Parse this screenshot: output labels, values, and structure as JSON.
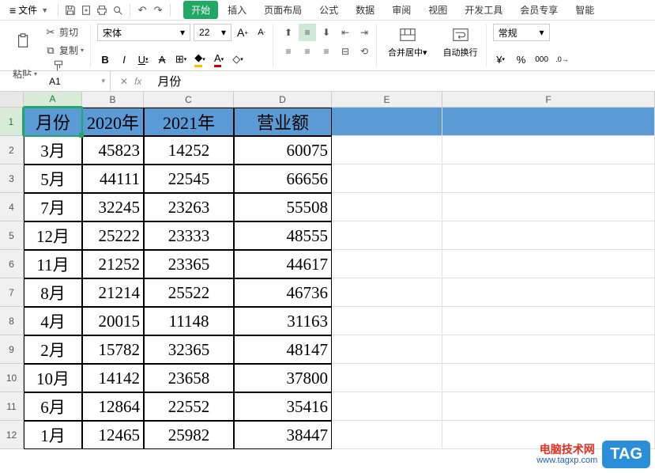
{
  "menubar": {
    "file": "文件",
    "tabs": [
      "开始",
      "插入",
      "页面布局",
      "公式",
      "数据",
      "审阅",
      "视图",
      "开发工具",
      "会员专享",
      "智能"
    ]
  },
  "ribbon": {
    "paste": "粘贴",
    "cut": "剪切",
    "copy": "复制",
    "format_painter": "格式刷",
    "font_name": "宋体",
    "font_size": "22",
    "merge_center": "合并居中",
    "wrap_text": "自动换行",
    "number_format": "常规"
  },
  "namebox": "A1",
  "formula": "月份",
  "columns": [
    "A",
    "B",
    "C",
    "D",
    "E",
    "F"
  ],
  "header": [
    "月份",
    "2020年",
    "2021年",
    "营业额"
  ],
  "rows": [
    [
      "3月",
      "45823",
      "14252",
      "60075"
    ],
    [
      "5月",
      "44111",
      "22545",
      "66656"
    ],
    [
      "7月",
      "32245",
      "23263",
      "55508"
    ],
    [
      "12月",
      "25222",
      "23333",
      "48555"
    ],
    [
      "11月",
      "21252",
      "23365",
      "44617"
    ],
    [
      "8月",
      "21214",
      "25522",
      "46736"
    ],
    [
      "4月",
      "20015",
      "11148",
      "31163"
    ],
    [
      "2月",
      "15782",
      "32365",
      "48147"
    ],
    [
      "10月",
      "14142",
      "23658",
      "37800"
    ],
    [
      "6月",
      "12864",
      "22552",
      "35416"
    ],
    [
      "1月",
      "12465",
      "25982",
      "38447"
    ]
  ],
  "watermark": {
    "line1": "电脑技术网",
    "line2": "www.tagxp.com",
    "tag": "TAG"
  }
}
